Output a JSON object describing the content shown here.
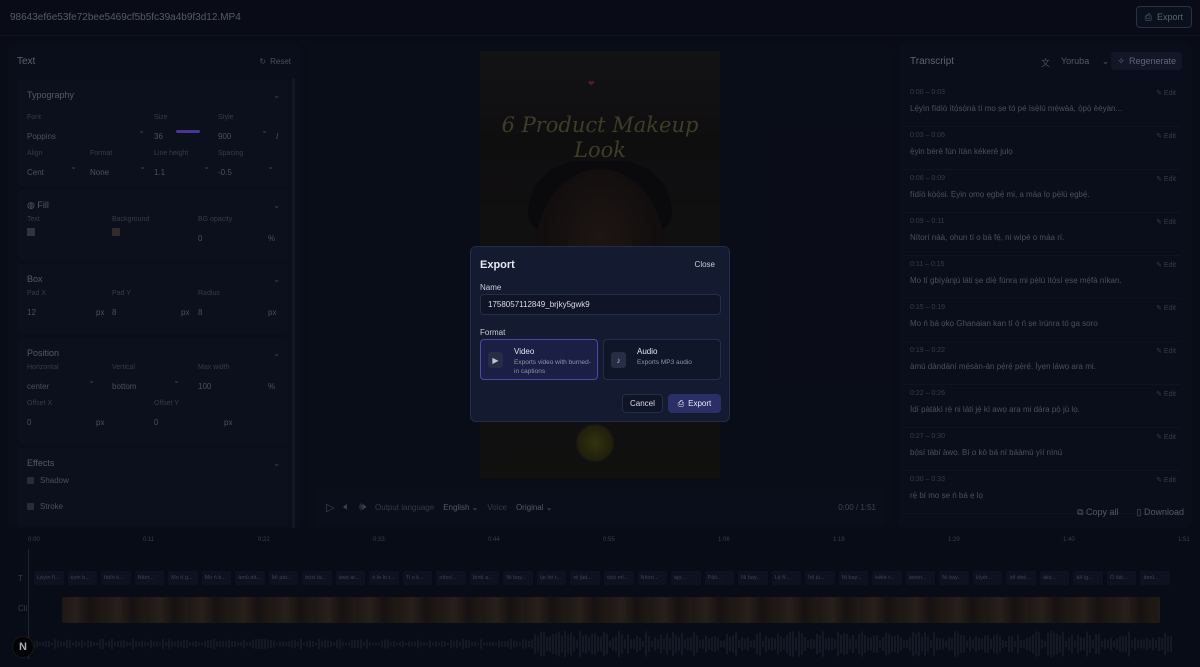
{
  "topbar": {
    "filename": "98643ef6e53fe72bee5469cf5b5fc39a4b9f3d12.MP4",
    "export_label": "Export"
  },
  "left": {
    "title": "Text",
    "reset": "Reset",
    "typography": {
      "title": "Typography",
      "font_lbl": "Font",
      "font": "Poppins",
      "size_lbl": "Size",
      "size": "36",
      "style_lbl": "Style",
      "style": "900",
      "italic": "I",
      "align_lbl": "Align",
      "align": "Cent",
      "format_lbl": "Format",
      "format": "None",
      "lh_lbl": "Line height",
      "lh": "1.1",
      "spacing_lbl": "Spacing",
      "spacing": "-0.5"
    },
    "fill": {
      "title": "Fill",
      "text_lbl": "Text",
      "bg_lbl": "Background",
      "op_lbl": "BG opacity",
      "op": "0",
      "pct": "%"
    },
    "box": {
      "title": "Box",
      "padx_lbl": "Pad X",
      "padx": "12",
      "pady_lbl": "Pad Y",
      "pady": "8",
      "radius_lbl": "Radius",
      "radius": "8",
      "px": "px"
    },
    "position": {
      "title": "Position",
      "h_lbl": "Horizontal",
      "h": "center",
      "v_lbl": "Vertical",
      "v": "bottom",
      "mw_lbl": "Max width",
      "mw": "100",
      "pct": "%",
      "ox_lbl": "Offset X",
      "ox": "0",
      "oy_lbl": "Offset Y",
      "oy": "0",
      "px": "px"
    },
    "effects": {
      "title": "Effects",
      "shadow": "Shadow",
      "stroke": "Stroke"
    }
  },
  "video": {
    "title_line1": "6 Product Makeup",
    "title_line2": "Look"
  },
  "controls": {
    "out_lbl": "Output language",
    "out": "English",
    "voice_lbl": "Voice",
    "voice": "Original",
    "time": "0:00 / 1:51"
  },
  "transcript": {
    "title": "Transcript",
    "lang": "Yoruba",
    "regen": "Regenerate",
    "edit": "Edit",
    "items": [
      {
        "time": "0:00 – 0:03",
        "text": "Lẹ́yìn fídíò ìtọ́sọ́nà tí mo ṣe tó pé ìsẹ̀lú mẹ́wàá, ọ̀pọ̀ èèyàn..."
      },
      {
        "time": "0:03 – 0:06",
        "text": "ẹ̀yin bèrè fún ìtàn kékeré julọ"
      },
      {
        "time": "0:06 – 0:09",
        "text": "fídíò kọ̀ọ̀si. Ẹyin ọmọ ẹgbẹ́ mi, a máa lọ pẹ̀lú ẹgbẹ́."
      },
      {
        "time": "0:09 – 0:11",
        "text": "Nítorí náà, ohun tí o bá fẹ́, ni wípé o máa rí."
      },
      {
        "time": "0:11 – 0:15",
        "text": "Mo tí gbìyànjú láti ṣe díẹ̀ fúnra mi pẹ̀lú ìtọ́sí ẹsẹ mẹ́fà nìkan."
      },
      {
        "time": "0:15 – 0:19",
        "text": "Mo ń bá ọkọ Ghanaian kan tí ó ń ṣe ìrúnra tó ga soro"
      },
      {
        "time": "0:19 – 0:22",
        "text": "àmù dàndàní mẹ́sàn-án pẹ́rẹ́ pẹ́rẹ́. Ìyẹn láwọ ara mi."
      },
      {
        "time": "0:22 – 0:26",
        "text": "Ìdí pàtàkì rẹ̀ ni láti jẹ́ kí awọ ara mi dára pọ̀ jù lọ."
      },
      {
        "time": "0:27 – 0:30",
        "text": "bọ́sí tàbí àwọ. Bí o kò bá ní báàmú yìí nìnú"
      },
      {
        "time": "0:30 – 0:33",
        "text": "rẹ̀ bí mo ṣe ń bá ẹ lọ"
      }
    ],
    "copy_all": "Copy all",
    "download": "Download"
  },
  "timeline": {
    "ticks": [
      "0:00",
      "0:11",
      "0:22",
      "0:33",
      "0:44",
      "0:55",
      "1:06",
      "1:18",
      "1:29",
      "1:40",
      "1:51"
    ],
    "cap_track_lbl": "T",
    "vid_track_lbl": "Cli",
    "captions": [
      "Lẹ́yìn fí...",
      "ẹ̀yin b...",
      "fídíò k...",
      "Nítor...",
      "Mo tí g...",
      "Mo ń b...",
      "àmù dà...",
      "Ìdí pàt...",
      "bọ́sí tà...",
      "àwọ ar...",
      "ó le lo t...",
      "Ti o k...",
      "nítorí...",
      "bíntí a...",
      "Ni bay...",
      "ìje ìtó t...",
      "rẹ̀ jàd...",
      "ọ̀ọ̀ọ̀ mí...",
      "Nítorí...",
      "ajọ...",
      "Pàtì...",
      "Ni bay...",
      "Lẹ́ fí...",
      "Ìdí jú...",
      "Ni bay...",
      "kékè r...",
      "àwon...",
      "Ni bay...",
      "kíyèr...",
      "ìdí ẹ̀bẹ̀...",
      "àkọ̀...",
      "àlí ìg...",
      "Ó láti...",
      "àmù..."
    ]
  },
  "modal": {
    "title": "Export",
    "close": "Close",
    "name_lbl": "Name",
    "name": "1758057112849_brjky5gwk9",
    "format_lbl": "Format",
    "video_t": "Video",
    "video_d": "Exports video with burned-in captions",
    "audio_t": "Audio",
    "audio_d": "Exports MP3 audio",
    "cancel": "Cancel",
    "export": "Export"
  },
  "logo": "N"
}
